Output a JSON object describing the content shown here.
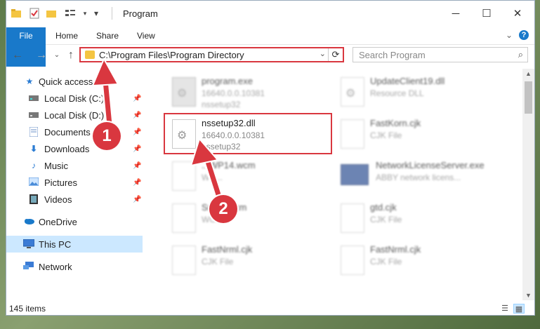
{
  "window": {
    "title": "Program",
    "quick_access_icons": [
      "folder-icon",
      "properties-icon",
      "new-folder-icon",
      "view-icon",
      "dropdown-icon"
    ]
  },
  "ribbon": {
    "tabs": [
      "File",
      "Home",
      "Share",
      "View"
    ]
  },
  "address": {
    "path": "C:\\Program Files\\Program Directory",
    "search_placeholder": "Search Program"
  },
  "sidebar": {
    "items": [
      {
        "label": "Quick access",
        "icon": "star-icon"
      },
      {
        "label": "Local Disk (C:)",
        "icon": "drive-icon",
        "pinned": true
      },
      {
        "label": "Local Disk (D:)",
        "icon": "drive-icon",
        "pinned": true
      },
      {
        "label": "Documents",
        "icon": "documents-icon",
        "pinned": true
      },
      {
        "label": "Downloads",
        "icon": "download-icon",
        "pinned": true
      },
      {
        "label": "Music",
        "icon": "music-icon",
        "pinned": true
      },
      {
        "label": "Pictures",
        "icon": "pictures-icon",
        "pinned": true
      },
      {
        "label": "Videos",
        "icon": "videos-icon",
        "pinned": true
      },
      {
        "label": "OneDrive",
        "icon": "cloud-icon"
      },
      {
        "label": "This PC",
        "icon": "computer-icon",
        "selected": true
      },
      {
        "label": "Network",
        "icon": "network-icon"
      }
    ]
  },
  "files": [
    {
      "name": "program.exe",
      "line1": "16640.0.0.10381",
      "line2": "nssetup32",
      "icon": "exe"
    },
    {
      "name": "UpdateClient19.dll",
      "line1": "Resource DLL",
      "line2": "",
      "icon": "dll"
    },
    {
      "name": "nssetup32.dll",
      "line1": "16640.0.0.10381",
      "line2": "nssetup32",
      "icon": "dll"
    },
    {
      "name": "FastKorn.cjk",
      "line1": "CJK File",
      "line2": "",
      "icon": "file"
    },
    {
      "name": "...WP14.wcm",
      "line1": "WC...",
      "line2": "",
      "icon": "file"
    },
    {
      "name": "NetworkLicenseServer.exe",
      "line1": "ABBY network licens...",
      "line2": "",
      "icon": "exe"
    },
    {
      "name": "Sn...6.wcm",
      "line1": "WC...",
      "line2": "",
      "icon": "file"
    },
    {
      "name": "gtd.cjk",
      "line1": "CJK File",
      "line2": "",
      "icon": "file"
    },
    {
      "name": "FastNrml.cjk",
      "line1": "CJK File",
      "line2": "",
      "icon": "file"
    },
    {
      "name": "FastNrml.cjk",
      "line1": "CJK File",
      "line2": "",
      "icon": "file"
    }
  ],
  "status": {
    "item_count": "145 items"
  },
  "annotations": {
    "step1": "1",
    "step2": "2",
    "highlight_color": "#d9373f"
  },
  "colors": {
    "accent": "#1979ca",
    "selection": "#cce8ff"
  }
}
